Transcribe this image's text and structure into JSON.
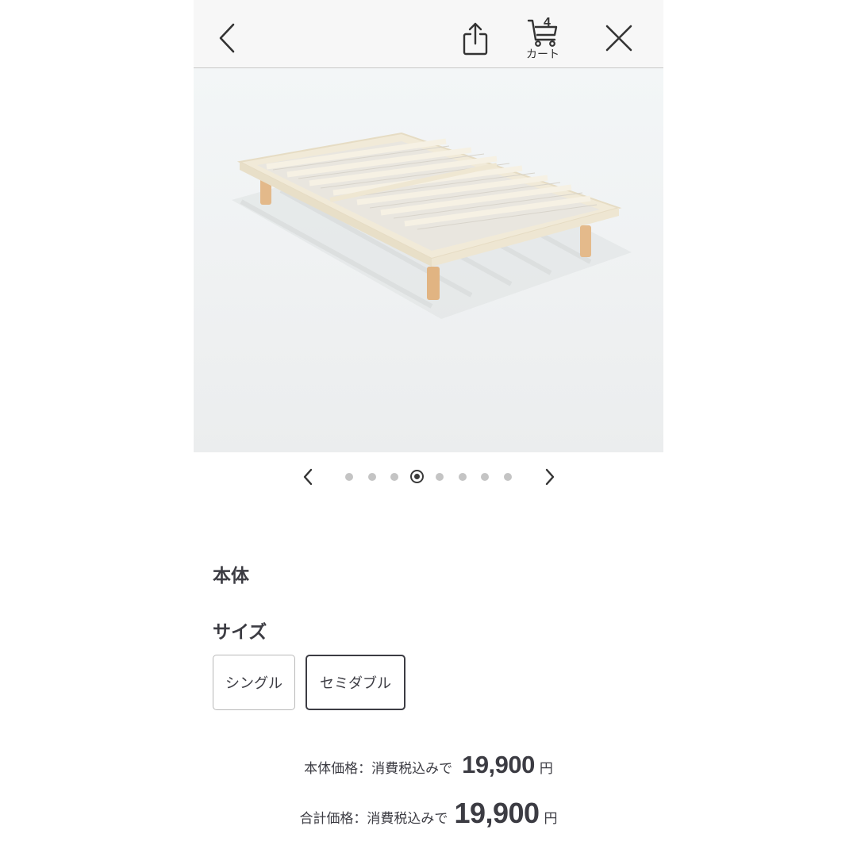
{
  "topbar": {
    "back_icon": "chevron-left-icon",
    "share_icon": "share-icon",
    "cart": {
      "icon": "cart-icon",
      "count": "4",
      "label": "カート"
    },
    "close_icon": "close-icon"
  },
  "hero": {
    "image": "bed-frame-product-image",
    "frame_color": "#f1ead8",
    "leg_color": "#e3b98a"
  },
  "pager": {
    "prev_icon": "chevron-left-icon",
    "next_icon": "chevron-right-icon",
    "total": 8,
    "active_index": 3
  },
  "product": {
    "section_title": "本体",
    "size_title": "サイズ",
    "sizes": [
      {
        "label": "シングル",
        "selected": false
      },
      {
        "label": "セミダブル",
        "selected": true
      }
    ]
  },
  "prices": {
    "body": {
      "label": "本体価格：消費税込みで",
      "amount": "19,900",
      "unit": "円"
    },
    "total": {
      "label": "合計価格：消費税込みで",
      "amount": "19,900",
      "unit": "円"
    }
  },
  "colors": {
    "text": "#3c3c43",
    "topbar_bg": "#f7f7f7",
    "dot_inactive": "#c4c4c4",
    "dot_active": "#3a3a3a"
  }
}
